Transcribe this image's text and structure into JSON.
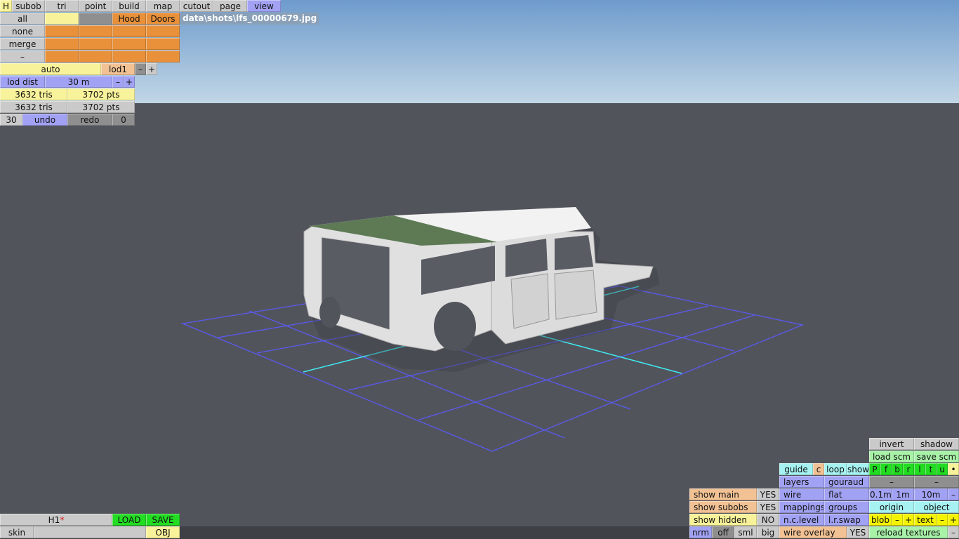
{
  "file_label": "data\\shots\\lfs_00000679.jpg",
  "colors": {
    "sky_top": "#6e9bcc",
    "sky_bottom": "#c0d6e6",
    "ground": "#52545c",
    "grid": "#5a5af0",
    "grid_axis": "#40e8f0",
    "body": "#e2e2e2",
    "roof_green": "#5e7a55"
  },
  "buttons": {
    "h": "H",
    "subob": "subob",
    "tri": "tri",
    "point": "point",
    "build": "build",
    "map": "map",
    "cutout": "cutout",
    "page": "page",
    "view": "view",
    "all": "all",
    "sel-yellow": "",
    "sel-gray": "",
    "hood": "Hood",
    "doors": "Doors",
    "none": "none",
    "merge": "merge",
    "dash": "–",
    "auto": "auto",
    "lod1": "lod1",
    "lod-minus": "–",
    "lod-plus": "+",
    "lod-dist": "lod dist",
    "lod-dist-value": "30 m",
    "lod-dist-minus": "–",
    "lod-dist-plus": "+",
    "tris1": "3632 tris",
    "pts1": "3702 pts",
    "tris2": "3632 tris",
    "pts2": "3702 pts",
    "undo-count": "30",
    "undo": "undo",
    "redo": "redo",
    "redo-count": "0",
    "h1": "H1",
    "load": "LOAD",
    "save": "SAVE",
    "skin": "skin",
    "skin-field": "",
    "obj": "OBJ",
    "invert": "invert",
    "shadow": "shadow",
    "load-scm": "load scm",
    "save-scm": "save scm",
    "guide": "guide",
    "c": "c",
    "loop": "loop",
    "show": "show",
    "p": "P",
    "f": "f",
    "bk": "b",
    "r": "r",
    "lf": "l",
    "t": "t",
    "u": "u",
    "dot": "•",
    "layers": "layers",
    "gouraud": "gouraud",
    "dash1": "–",
    "dash2": "–",
    "show-main": "show main",
    "show-main-val": "YES",
    "wire": "wire",
    "flat": "flat",
    "m01": "0.1m",
    "m1": "1m",
    "m10": "10m",
    "m-minus": "–",
    "show-subobs": "show subobs",
    "show-subobs-val": "YES",
    "mappings": "mappings",
    "groups": "groups",
    "origin": "origin",
    "object": "object",
    "show-hidden": "show hidden",
    "show-hidden-val": "NO",
    "nc-level": "n.c.level",
    "lr-swap": "l.r.swap",
    "blob": "blob",
    "blob-minus": "–",
    "blob-plus": "+",
    "text": "text",
    "text-minus": "–",
    "text-plus": "+",
    "nrm": "nrm",
    "off": "off",
    "sml": "sml",
    "big": "big",
    "wire-overlay": "wire overlay",
    "wire-overlay-val": "YES",
    "reload-textures": "reload textures",
    "reload-minus": "–"
  },
  "modified_marker": "*"
}
